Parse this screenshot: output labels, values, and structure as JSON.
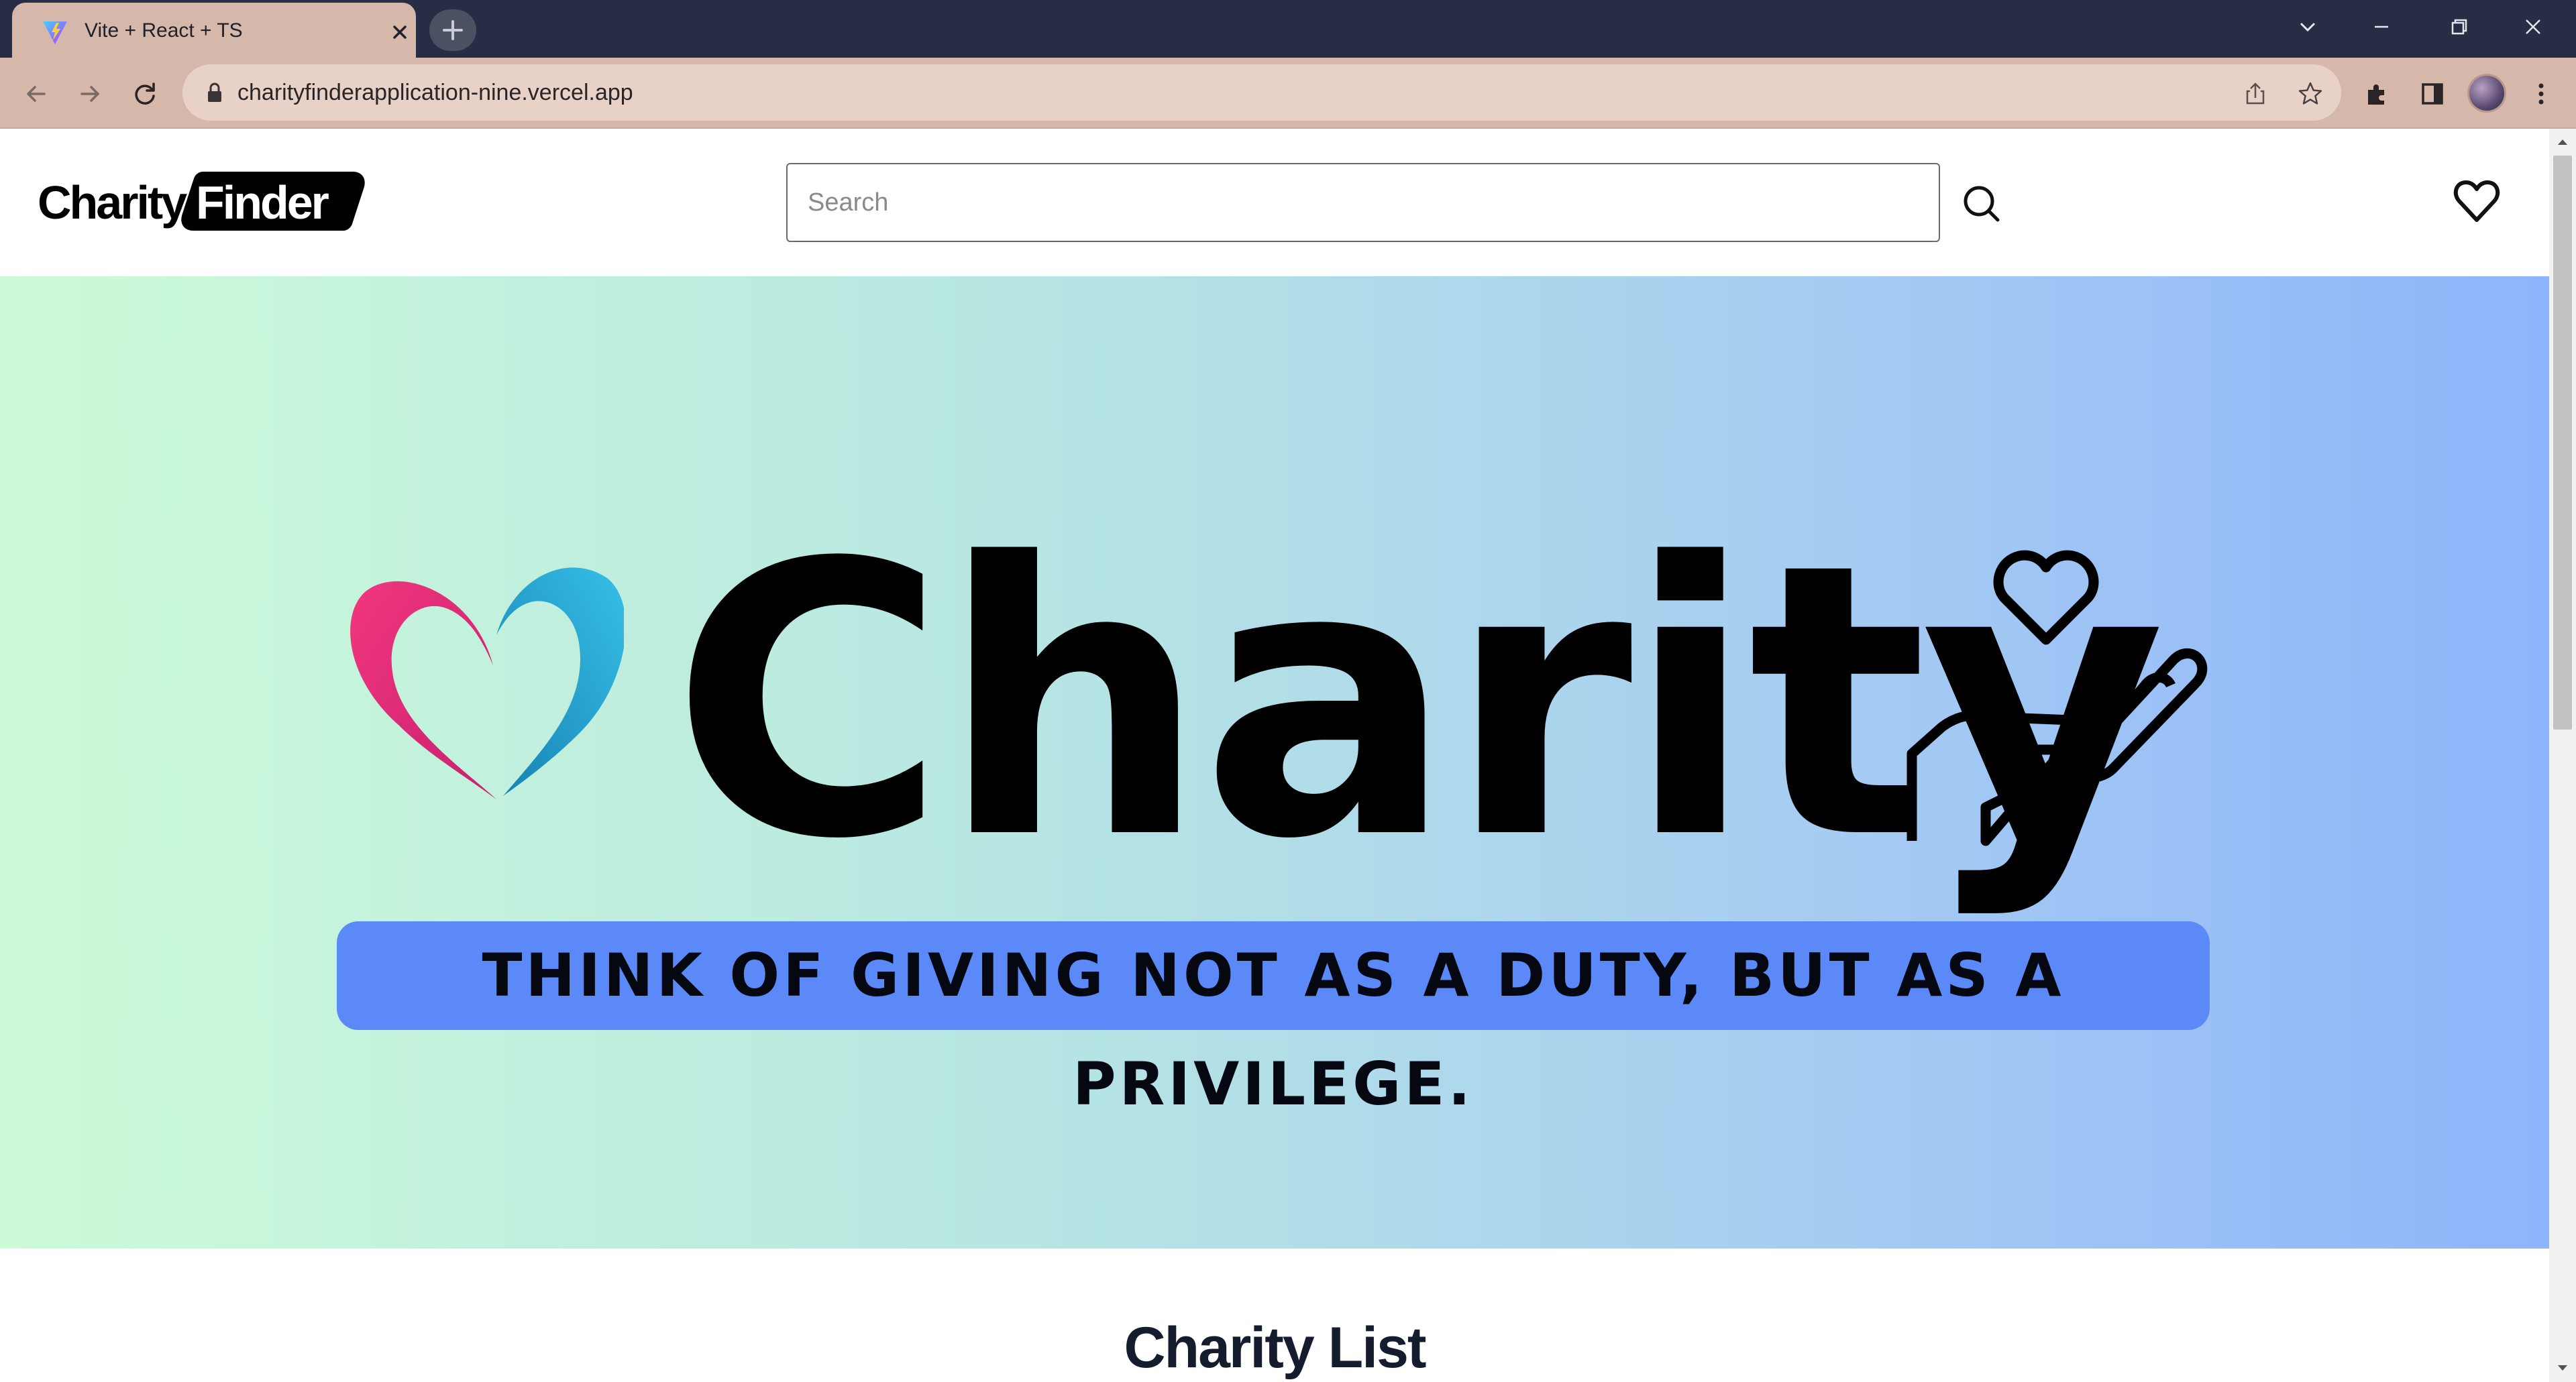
{
  "browser": {
    "tab_title": "Vite + React + TS",
    "url": "charityfinderapplication-nine.vercel.app"
  },
  "header": {
    "logo_part1": "Charity",
    "logo_part2": "Finder",
    "search_placeholder": "Search"
  },
  "hero": {
    "word": "Charity",
    "tagline": "THINK OF GIVING NOT AS A DUTY, BUT AS A PRIVILEGE.",
    "colors": {
      "gradient_start": "#ccfbd8",
      "gradient_end": "#8eb4fb",
      "tagline_bg": "#5b8af8",
      "heart_pink": "#e72e7e",
      "heart_blue": "#1fa3cf"
    }
  },
  "main": {
    "list_title": "Charity List"
  },
  "icons": [
    "vite-favicon-icon",
    "close-icon",
    "plus-icon",
    "back-icon",
    "forward-icon",
    "reload-icon",
    "lock-icon",
    "share-icon",
    "star-icon",
    "extensions-icon",
    "side-panel-icon",
    "menu-icon",
    "search-icon",
    "heart-icon",
    "hand-heart-icon"
  ]
}
